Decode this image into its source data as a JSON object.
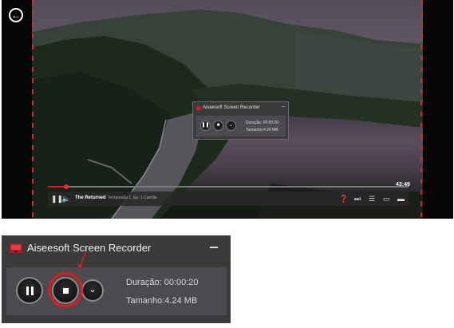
{
  "player": {
    "show_title": "The Returned",
    "episode_info": "Temporada 1, Ep. 1 Camille",
    "time_remaining": "43:49",
    "progress_fraction": 0.05,
    "back_icon": "back-arrow-icon",
    "accent_color": "#c8202a"
  },
  "mini_recorder": {
    "title": "Aiseesoft Screen Recorder",
    "minimize_glyph": "–",
    "duration_text": "Duração: 00:00:20",
    "size_text": "Tamanho:4.24 MB"
  },
  "recorder": {
    "title": "Aiseesoft Screen Recorder",
    "minimize_icon": "minimize-icon",
    "duration_label": "Duração:",
    "duration_value": "00:00:20",
    "size_label": "Tamanho:",
    "size_value": "4.24 MB",
    "buttons": [
      "pause-icon",
      "stop-icon",
      "chevron-down-icon"
    ],
    "highlight_color": "#d81e20"
  }
}
